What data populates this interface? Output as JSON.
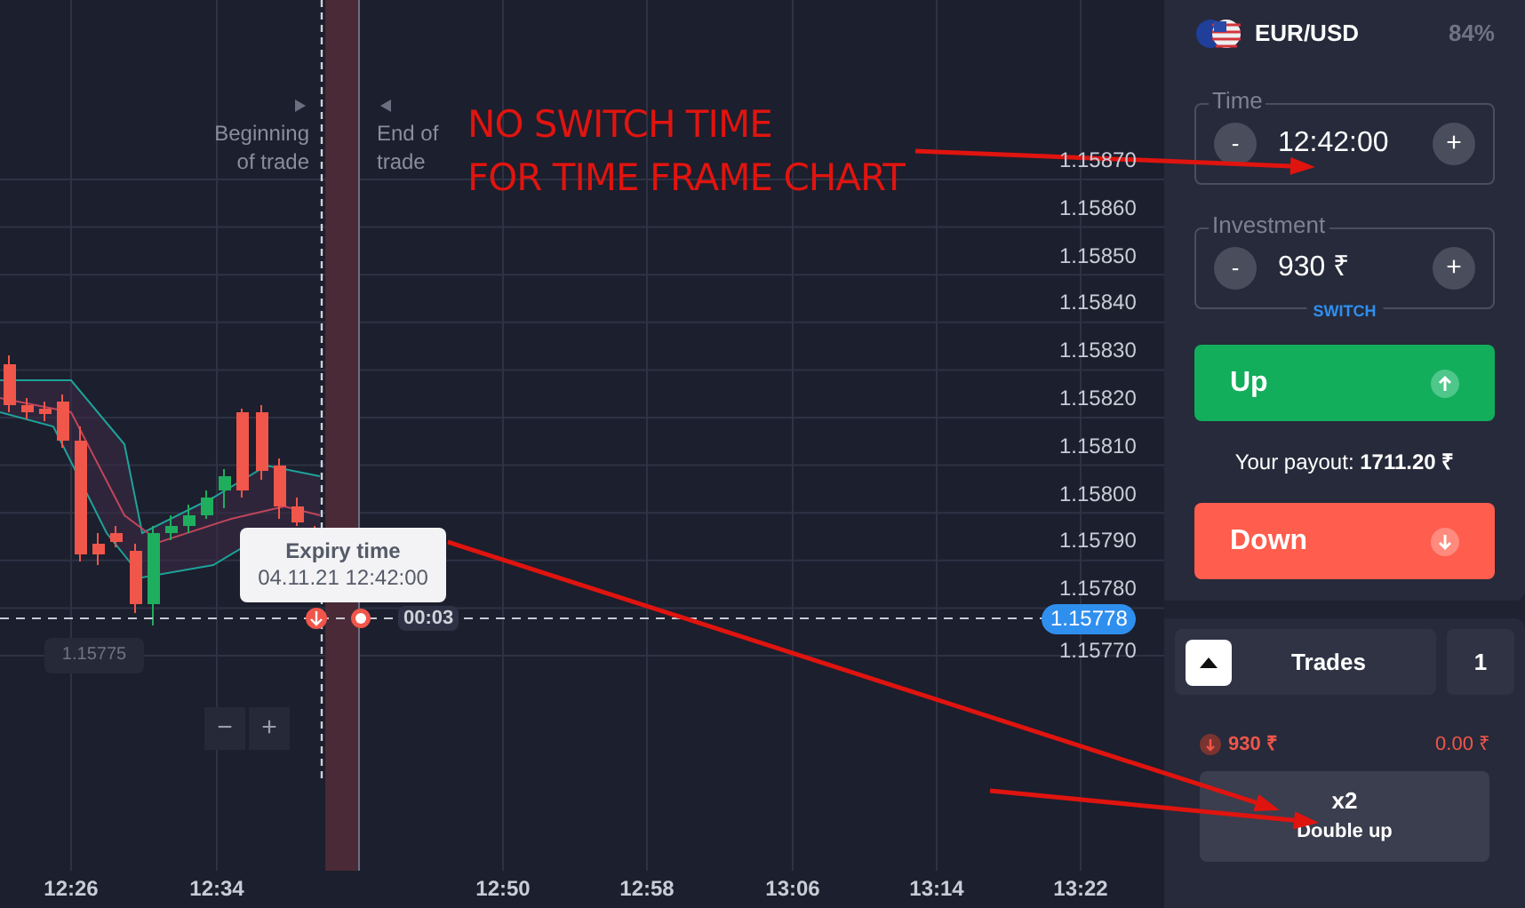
{
  "chart": {
    "price_labels": [
      "1.15870",
      "1.15860",
      "1.15850",
      "1.15840",
      "1.15830",
      "1.15820",
      "1.15810",
      "1.15800",
      "1.15790",
      "1.15780",
      "1.15770"
    ],
    "time_labels": [
      "12:26",
      "12:34",
      "12:50",
      "12:58",
      "13:06",
      "13:14",
      "13:22"
    ],
    "trade_start_label": "Beginning of trade",
    "trade_end_label": "End of trade",
    "expiry_tooltip": {
      "title": "Expiry time",
      "value": "04.11.21 12:42:00"
    },
    "countdown": "00:03",
    "current_price": "1.15778",
    "open_price": "1.15775",
    "zoom_buttons": [
      "−",
      "+"
    ]
  },
  "annotation": {
    "lines": [
      "NO SWITCH TIME",
      "FOR TIME FRAME CHART"
    ]
  },
  "asset": {
    "name": "EUR/USD",
    "payout_percent": "84%"
  },
  "time_field": {
    "label": "Time",
    "value": "12:42:00",
    "minus": "-",
    "plus": "+"
  },
  "investment_field": {
    "label": "Investment",
    "value": "930 ₹",
    "minus": "-",
    "plus": "+",
    "switch_link": "SWITCH"
  },
  "up_button": "Up",
  "payout": "Your payout: **1711.20 ₹**",
  "down_button": "Down",
  "trades": {
    "expanded": true,
    "label": "Trades",
    "count": "1",
    "items": [
      {
        "kind": "down",
        "amount": "930 ₹",
        "profit": "0.00 ₹"
      }
    ]
  },
  "double_up": {
    "multiplier": "x2",
    "label": "Double up"
  }
}
